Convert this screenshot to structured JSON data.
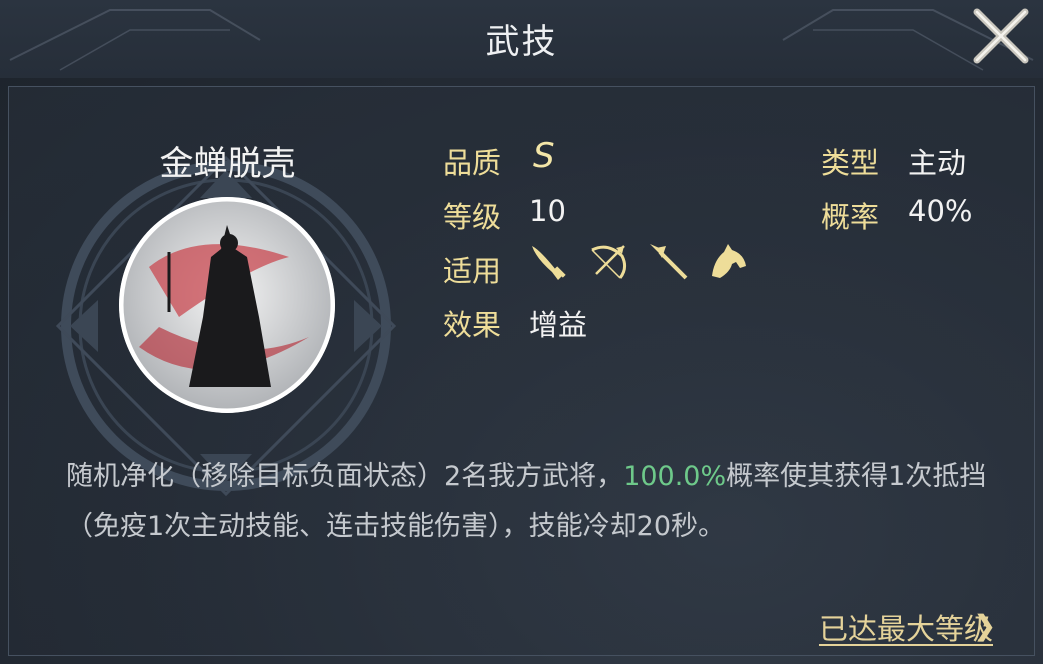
{
  "header": {
    "title": "武技"
  },
  "skill": {
    "name": "金蝉脱壳",
    "attributes": {
      "quality_label": "品质",
      "quality_value": "S",
      "level_label": "等级",
      "level_value": "10",
      "applies_label": "适用",
      "effect_label": "效果",
      "effect_value": "增益",
      "type_label": "类型",
      "type_value": "主动",
      "chance_label": "概率",
      "chance_value": "40%"
    },
    "applicable_units": [
      "sword-icon",
      "bow-icon",
      "spear-icon",
      "horse-icon"
    ],
    "description": {
      "part1": "随机净化（移除目标负面状态）2名我方武将，",
      "highlight": "100.0%",
      "part2": "概率使其获得1次抵挡（免疫1次主动技能、连击技能伤害），技能冷却20秒。"
    }
  },
  "footer": {
    "max_level_text": "已达最大等级",
    "chevron": "❯"
  },
  "colors": {
    "label_gold": "#eedd99",
    "highlight_green": "#6ec98a",
    "background": "#252c36"
  }
}
